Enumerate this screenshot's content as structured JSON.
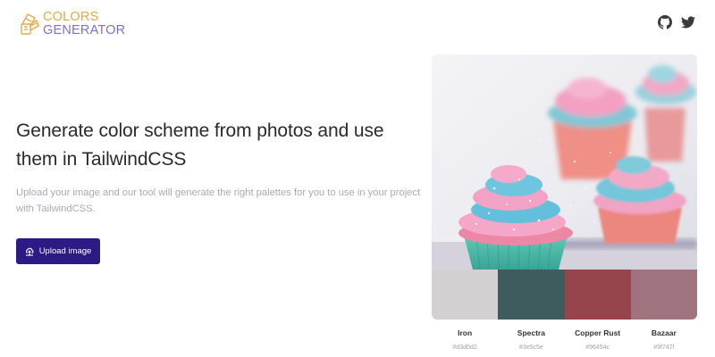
{
  "brand": {
    "line1": "COLORS",
    "line2": "GENERATOR"
  },
  "social": {
    "icons": [
      "github-icon",
      "twitter-icon"
    ]
  },
  "hero": {
    "headline": "Generate color scheme from photos and use them in TailwindCSS",
    "subtext": "Upload your image and our tool will generate the right palettes for you to use in your project with TailwindCSS.",
    "upload_label": "Upload image",
    "upload_icon": "upload-icon"
  },
  "palette": [
    {
      "name": "Iron",
      "hex": "#d3d0d2"
    },
    {
      "name": "Spectra",
      "hex": "#3e5c5e"
    },
    {
      "name": "Copper Rust",
      "hex": "#96454c"
    },
    {
      "name": "Bazaar",
      "hex": "#9f747f"
    }
  ],
  "colors": {
    "button": "#2e1a85",
    "logo_top": "#e3a94a",
    "logo_bottom": "#7d6fd0"
  }
}
